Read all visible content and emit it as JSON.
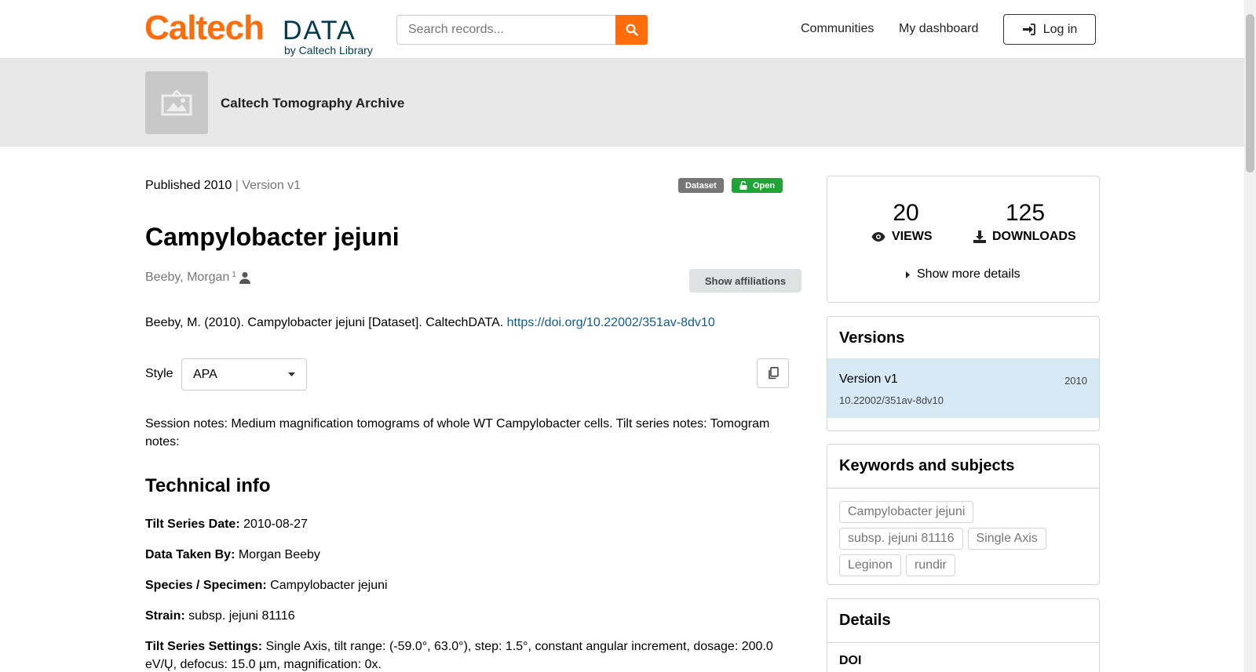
{
  "header": {
    "logo_main": "Caltech",
    "logo_data": "DATA",
    "logo_sub": "by Caltech Library",
    "search_placeholder": "Search records...",
    "nav": [
      "Communities",
      "My dashboard"
    ],
    "login_label": "Log in",
    "accent_color": "#ff6c0c"
  },
  "community": {
    "name": "Caltech Tomography Archive"
  },
  "record": {
    "published": "Published 2010",
    "version_sep": " | ",
    "version": "Version v1",
    "badge_type": "Dataset",
    "badge_access": "Open",
    "title": "Campylobacter jejuni",
    "creator": "Beeby, Morgan",
    "creator_affil_num": "1",
    "show_affiliations": "Show affiliations",
    "citation_text": "Beeby, M. (2010). Campylobacter jejuni [Dataset]. CaltechDATA. ",
    "citation_doi": "https://doi.org/10.22002/351av-8dv10",
    "style_label": "Style",
    "style_value": "APA",
    "description": "Session notes: Medium magnification tomograms of whole WT Campylobacter cells. Tilt series notes: Tomogram notes:",
    "technical_heading": "Technical info",
    "fields": [
      {
        "label": "Tilt Series Date:",
        "value": " 2010-08-27"
      },
      {
        "label": "Data Taken By:",
        "value": " Morgan Beeby"
      },
      {
        "label": "Species / Specimen:",
        "value": " Campylobacter jejuni"
      },
      {
        "label": "Strain:",
        "value": " subsp. jejuni 81116"
      },
      {
        "label": "Tilt Series Settings:",
        "value": " Single Axis, tilt range: (-59.0°, 63.0°), step: 1.5°, constant angular increment, dosage: 200.0 eV/Ų, defocus: 15.0 µm, magnification: 0x."
      }
    ]
  },
  "sidebar": {
    "views_count": "20",
    "views_label": "VIEWS",
    "downloads_count": "125",
    "downloads_label": "DOWNLOADS",
    "more_details": "Show more details",
    "versions_heading": "Versions",
    "version_name": "Version v1",
    "version_year": "2010",
    "version_doi": "10.22002/351av-8dv10",
    "keywords_heading": "Keywords and subjects",
    "keywords": [
      "Campylobacter jejuni",
      "subsp. jejuni 81116",
      "Single Axis",
      "Leginon",
      "rundir"
    ],
    "details_heading": "Details",
    "details_doi_label": "DOI"
  }
}
